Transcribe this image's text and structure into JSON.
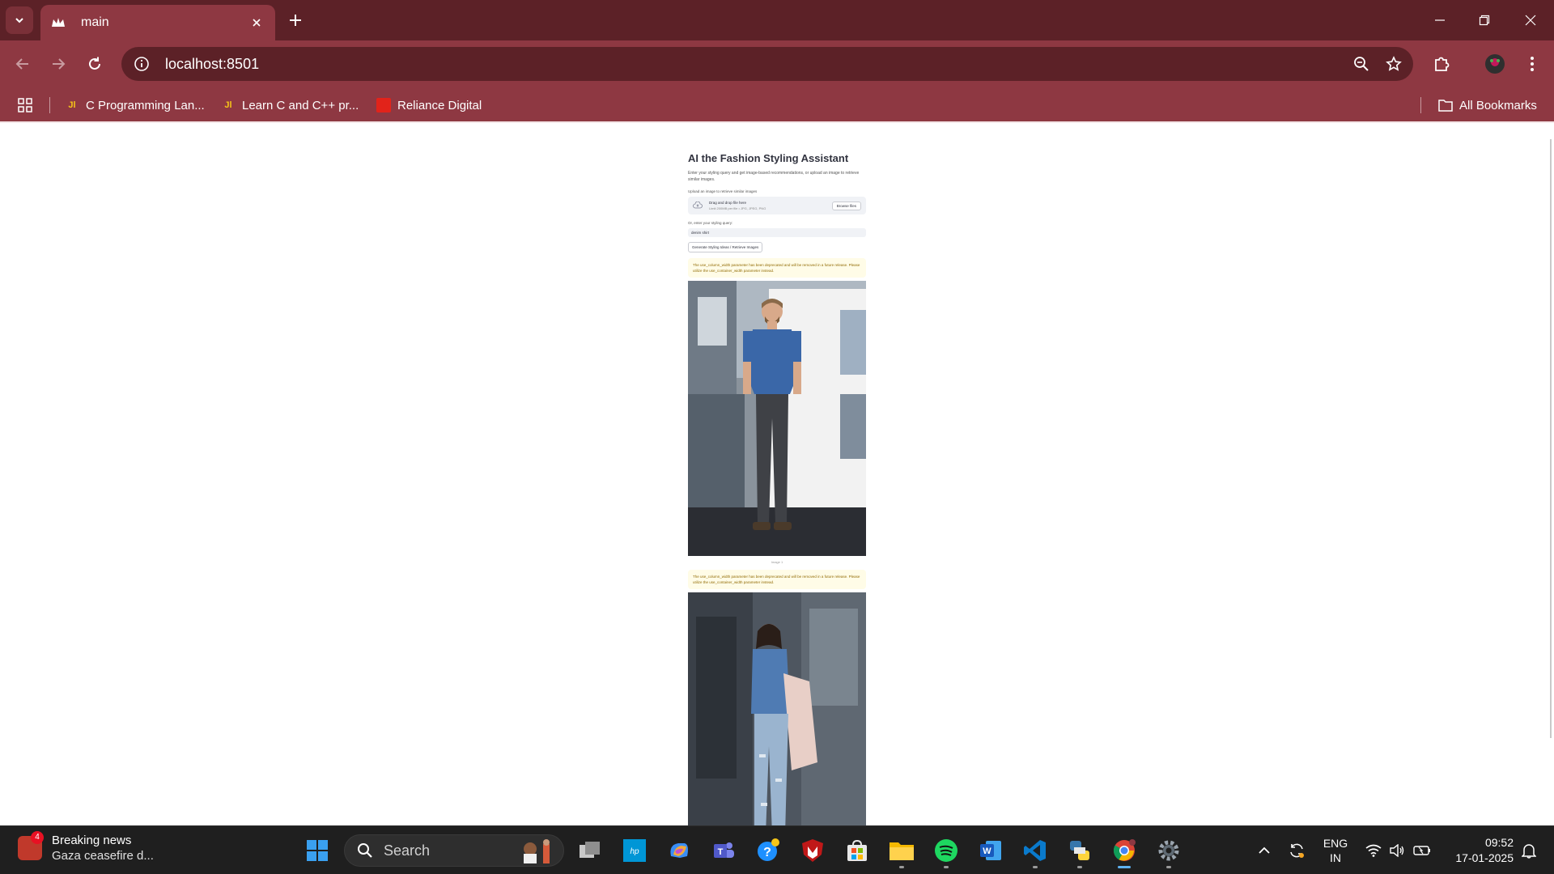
{
  "browser": {
    "tab_title": "main",
    "url": "localhost:8501",
    "bookmarks": [
      {
        "label": "C Programming Lan...",
        "icon": "jetbrains-icon"
      },
      {
        "label": "Learn C and C++ pr...",
        "icon": "jetbrains-icon"
      },
      {
        "label": "Reliance Digital",
        "icon": "reliance-icon"
      }
    ],
    "all_bookmarks": "All Bookmarks",
    "theme_color": "#8e3842"
  },
  "app": {
    "title": "AI the Fashion Styling Assistant",
    "subtitle": "Enter your styling query and get image-based recommendations, or upload an image to retrieve similar images.",
    "upload_label": "Upload an image to retrieve similar images",
    "drag_text": "Drag and drop file here",
    "limit_text": "Limit 200MB per file • JPG, JPEG, PNG",
    "browse_label": "Browse files",
    "query_label": "Or, enter your styling query:",
    "query_value": "denim shirt",
    "action_label": "Generate Styling Ideas / Retrieve Images",
    "warning_1": "The use_column_width parameter has been deprecated and will be removed in a future release. Please utilize the use_container_width parameter instead.",
    "caption_1": "Image 1",
    "warning_2": "The use_column_width parameter has been deprecated and will be removed in a future release. Please utilize the use_container_width parameter instead."
  },
  "taskbar": {
    "news_badge": "4",
    "news_title": "Breaking news",
    "news_sub": "Gaza ceasefire d...",
    "search_placeholder": "Search",
    "lang_top": "ENG",
    "lang_bottom": "IN",
    "time": "09:52",
    "date": "17-01-2025"
  }
}
